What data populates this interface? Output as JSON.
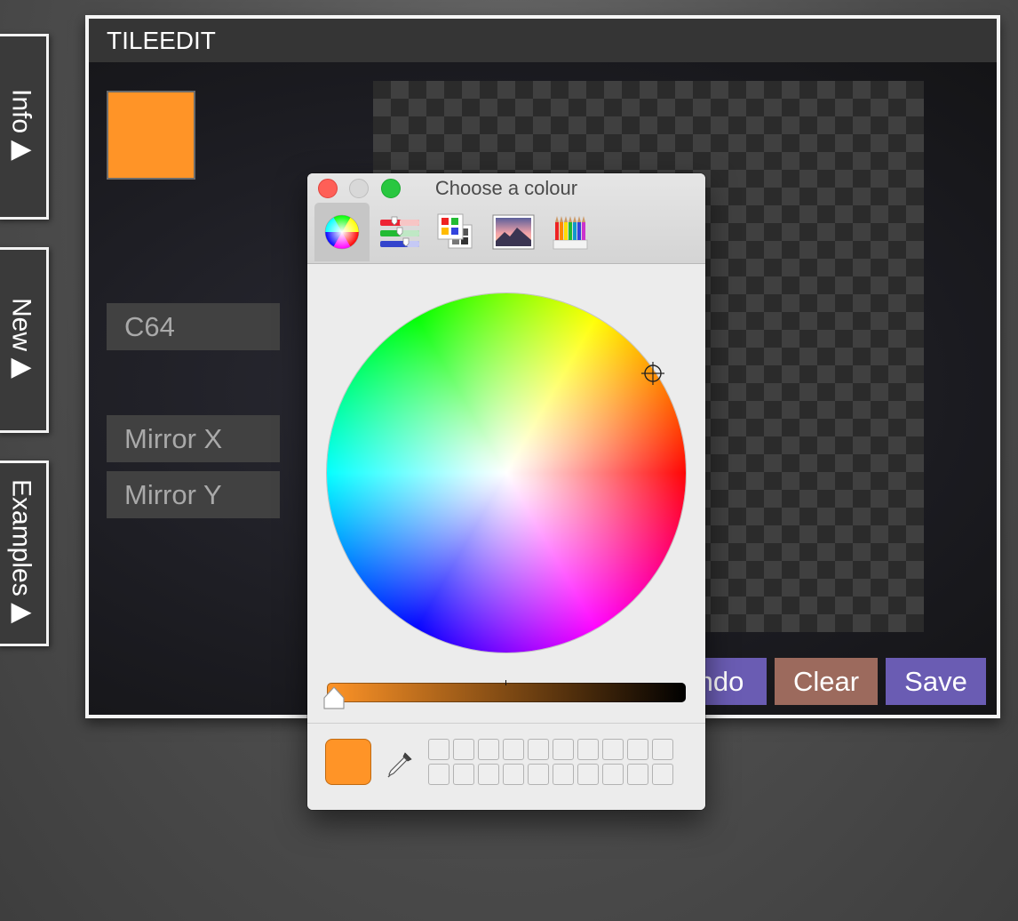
{
  "side_tabs": [
    {
      "label": "Info▶"
    },
    {
      "label": "New▶"
    },
    {
      "label": "Examples▶"
    }
  ],
  "app": {
    "title": "TILEEDIT",
    "current_colour": "#ff9427",
    "palette_label": "C64",
    "mirror_x_label": "Mirror X",
    "mirror_y_label": "Mirror Y",
    "undo_label": "ndo",
    "clear_label": "Clear",
    "save_label": "Save",
    "colors": {
      "undo": "#6a5cb3",
      "clear": "#9c6a5d",
      "save": "#6a5cb3"
    }
  },
  "colour_picker": {
    "title": "Choose a colour",
    "modes": [
      {
        "icon": "colour-wheel-icon",
        "active": true
      },
      {
        "icon": "colour-sliders-icon",
        "active": false
      },
      {
        "icon": "colour-palettes-icon",
        "active": false
      },
      {
        "icon": "image-palettes-icon",
        "active": false
      },
      {
        "icon": "pencils-icon",
        "active": false
      }
    ],
    "brightness": 1.0,
    "selected_colour": "#ff9427",
    "swatch_slots": 20
  }
}
